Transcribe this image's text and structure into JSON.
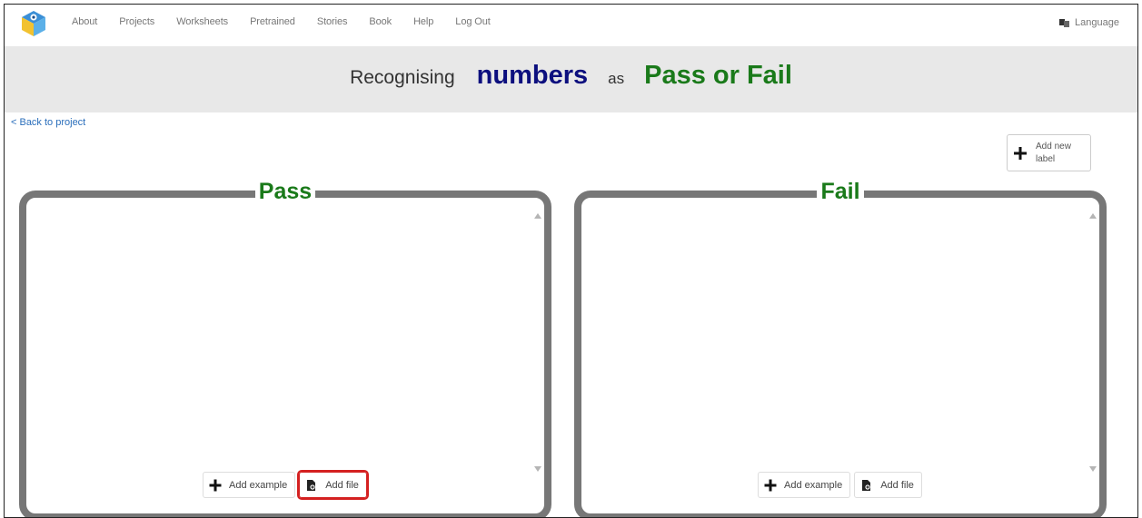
{
  "nav": {
    "items": [
      "About",
      "Projects",
      "Worksheets",
      "Pretrained",
      "Stories",
      "Book",
      "Help",
      "Log Out"
    ],
    "language": "Language"
  },
  "title": {
    "prefix": "Recognising",
    "type": "numbers",
    "middle": "as",
    "project": "Pass or Fail"
  },
  "back_link": "< Back to project",
  "add_label": {
    "line1": "Add new",
    "line2": "label"
  },
  "labels": [
    {
      "name": "Pass",
      "add_example": "Add example",
      "add_file": "Add file"
    },
    {
      "name": "Fail",
      "add_example": "Add example",
      "add_file": "Add file"
    }
  ],
  "colors": {
    "accent_navy": "#0c0f7e",
    "accent_green": "#1a7a1a",
    "highlight_red": "#d42020"
  }
}
